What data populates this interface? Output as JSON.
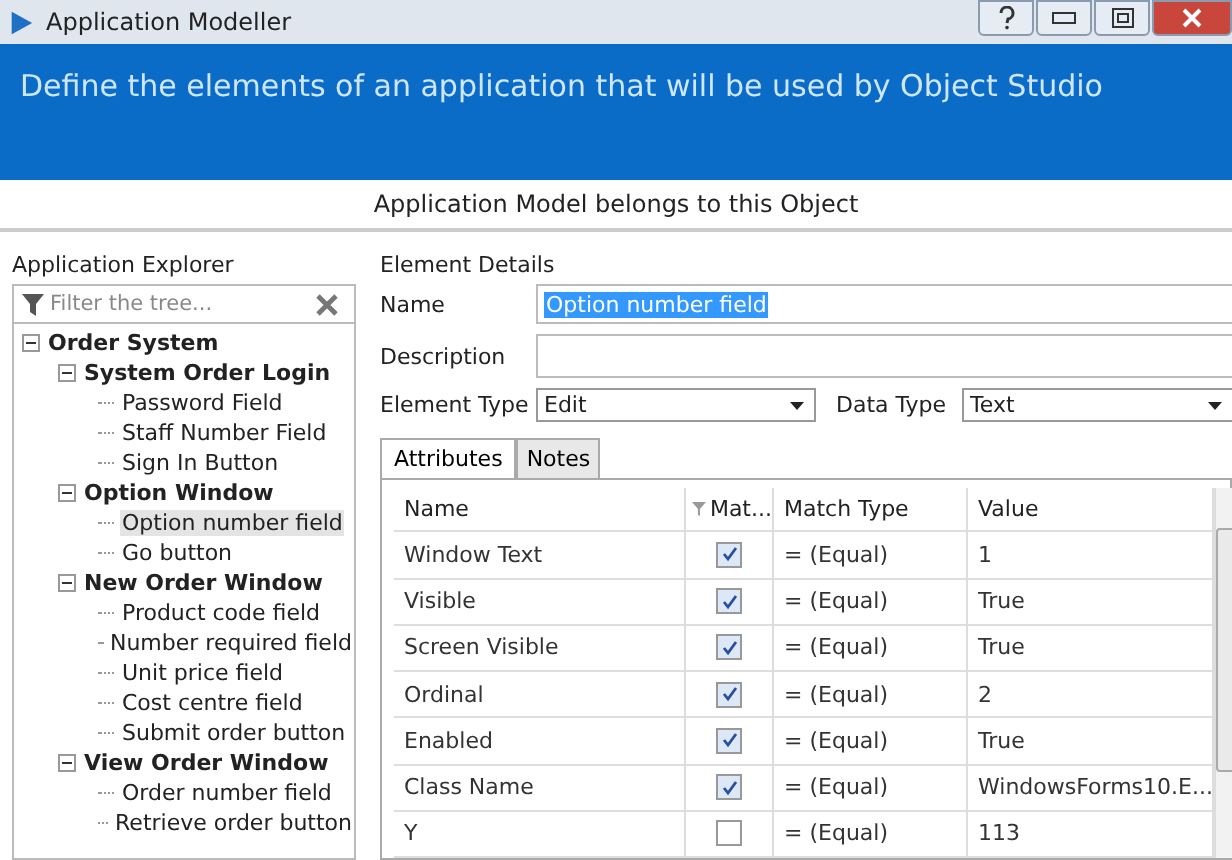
{
  "window": {
    "title": "Application Modeller"
  },
  "banner": {
    "text": "Define the elements of an application that will be used by Object Studio"
  },
  "subtitle": "Application Model belongs to this Object",
  "explorer": {
    "title": "Application Explorer",
    "filter": {
      "placeholder": "Filter the tree..."
    },
    "tree": [
      {
        "label": "Order System",
        "expanded": true,
        "selected": false,
        "children": [
          {
            "label": "System Order Login",
            "expanded": true,
            "selected": false,
            "children": [
              {
                "label": "Password Field",
                "selected": false
              },
              {
                "label": "Staff Number Field",
                "selected": false
              },
              {
                "label": "Sign In Button",
                "selected": false
              }
            ]
          },
          {
            "label": "Option Window",
            "expanded": true,
            "selected": false,
            "children": [
              {
                "label": "Option number field",
                "selected": true
              },
              {
                "label": "Go button",
                "selected": false
              }
            ]
          },
          {
            "label": "New Order Window",
            "expanded": true,
            "selected": false,
            "children": [
              {
                "label": "Product code field",
                "selected": false
              },
              {
                "label": "Number required field",
                "selected": false
              },
              {
                "label": "Unit price field",
                "selected": false
              },
              {
                "label": "Cost centre field",
                "selected": false
              },
              {
                "label": "Submit order button",
                "selected": false
              }
            ]
          },
          {
            "label": "View Order Window",
            "expanded": true,
            "selected": false,
            "children": [
              {
                "label": "Order number field",
                "selected": false
              },
              {
                "label": "Retrieve order button",
                "selected": false
              }
            ]
          }
        ]
      }
    ]
  },
  "details": {
    "title": "Element Details",
    "name": {
      "label": "Name",
      "value": "Option number field"
    },
    "description": {
      "label": "Description"
    },
    "element_type": {
      "label": "Element Type",
      "value": "Edit"
    },
    "data_type": {
      "label": "Data Type",
      "value": "Text"
    },
    "tabs": [
      {
        "label": "Attributes",
        "selected": true
      },
      {
        "label": "Notes",
        "selected": false
      }
    ],
    "table": {
      "columns": [
        "Name",
        "Mat...",
        "Match Type",
        "Value"
      ],
      "rows": [
        {
          "name": "Window Text",
          "checked": true,
          "match_type": "= (Equal)",
          "value": "1"
        },
        {
          "name": "Visible",
          "checked": true,
          "match_type": "= (Equal)",
          "value": "True"
        },
        {
          "name": "Screen Visible",
          "checked": true,
          "match_type": "= (Equal)",
          "value": "True"
        },
        {
          "name": "Ordinal",
          "checked": true,
          "match_type": "= (Equal)",
          "value": "2"
        },
        {
          "name": "Enabled",
          "checked": true,
          "match_type": "= (Equal)",
          "value": "True"
        },
        {
          "name": "Class Name",
          "checked": true,
          "match_type": "= (Equal)",
          "value": "WindowsForms10.E..."
        },
        {
          "name": "Y",
          "checked": false,
          "match_type": "= (Equal)",
          "value": "113"
        }
      ]
    }
  }
}
